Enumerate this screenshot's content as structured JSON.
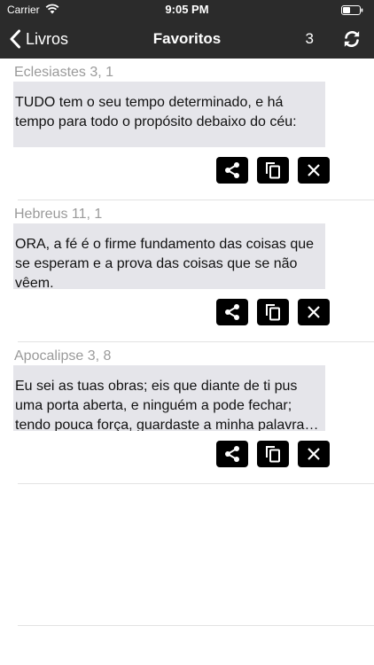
{
  "status_bar": {
    "carrier": "Carrier",
    "time": "9:05 PM"
  },
  "nav": {
    "back_label": "Livros",
    "title": "Favoritos",
    "count": "3",
    "icons": {
      "back": "chevron-left-icon",
      "refresh": "refresh-icon"
    }
  },
  "favorites": [
    {
      "reference": "Eclesiastes 3, 1",
      "text": "TUDO tem o seu tempo determinado, e há tempo para todo o propósito debaixo do céu:"
    },
    {
      "reference": "Hebreus 11, 1",
      "text": "ORA, a fé é o firme fundamento das coisas que se esperam e a prova das coisas que se não vêem."
    },
    {
      "reference": "Apocalipse 3, 8",
      "text": "Eu sei as tuas obras; eis que diante de ti pus uma porta aberta, e ninguém a pode fechar; tendo pouca força, guardaste a minha palavra…"
    }
  ],
  "actions": {
    "icons": [
      "share-icon",
      "copy-icon",
      "close-icon"
    ]
  },
  "colors": {
    "bar_background": "#2b2b2b",
    "verse_background": "#e5e5ea",
    "reference_text": "#9a9a9a",
    "button_background": "#000000"
  }
}
